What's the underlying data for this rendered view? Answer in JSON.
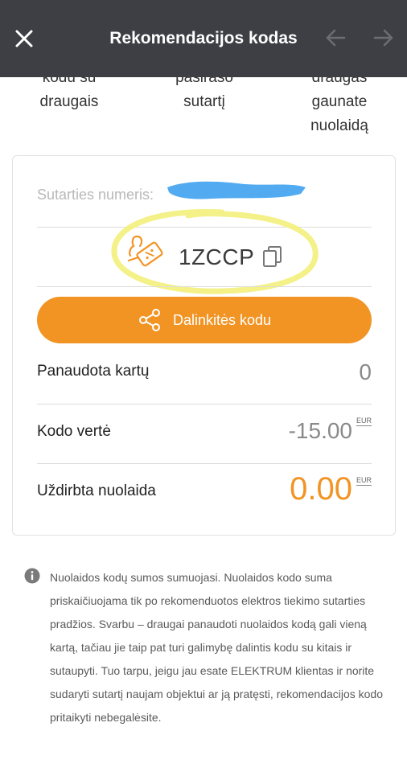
{
  "header": {
    "title": "Rekomendacijos kodas",
    "close_icon": "close-icon",
    "back_icon": "arrow-left-icon",
    "forward_icon": "arrow-right-icon"
  },
  "steps": [
    {
      "text_line1": "kodu su",
      "text_line2": "draugais"
    },
    {
      "text_line1": "pasirašo",
      "text_line2": "sutartį"
    },
    {
      "text_line1": "draugas",
      "text_line2": "gaunate",
      "text_line3": "nuolaidą"
    }
  ],
  "card": {
    "contract_label": "Sutarties numeris:",
    "code": "1ZCCP",
    "share_button": "Dalinkitės kodu",
    "rows": [
      {
        "label": "Panaudota kartų",
        "value": "0",
        "currency": ""
      },
      {
        "label": "Kodo vertė",
        "value": "-15.00",
        "currency": "EUR"
      },
      {
        "label": "Uždirbta nuolaida",
        "value": "0.00",
        "currency": "EUR"
      }
    ]
  },
  "info": {
    "text": "Nuolaidos kodų sumos sumuojasi. Nuolaidos kodo suma priskaičiuojama tik po rekomenduotos elektros tiekimo sutarties pradžios. Svarbu – draugai panaudoti nuolaidos kodą gali vieną kartą, tačiau jie taip pat turi galimybę dalintis kodu su kitais ir sutaupyti. Tuo tarpu, jeigu jau esate ELEKTRUM klientas ir norite sudaryti sutartį naujam objektui ar ją pratęsti, rekomendacijos kodo pritaikyti nebegalėsite."
  },
  "colors": {
    "header_bg": "#3d3f44",
    "accent_orange": "#f29424",
    "highlight_yellow": "#f2ef7a",
    "redaction_blue": "#3fa2f0"
  }
}
